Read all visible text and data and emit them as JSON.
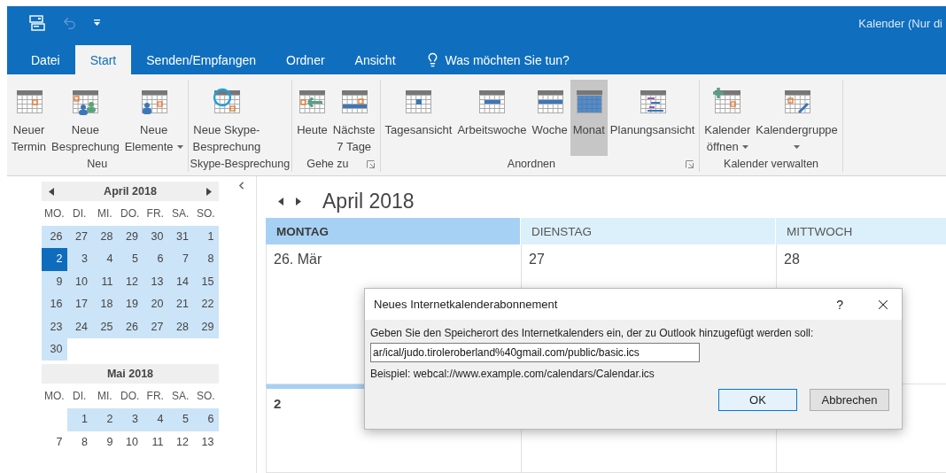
{
  "window": {
    "title": "Kalender (Nur di"
  },
  "tabs": [
    {
      "label": "Datei",
      "selected": false
    },
    {
      "label": "Start",
      "selected": true
    },
    {
      "label": "Senden/Empfangen",
      "selected": false
    },
    {
      "label": "Ordner",
      "selected": false
    },
    {
      "label": "Ansicht",
      "selected": false
    }
  ],
  "tell_me": {
    "placeholder": "Was möchten Sie tun?"
  },
  "ribbon_groups": [
    {
      "label": "Neu",
      "launcher": false,
      "buttons": [
        {
          "kind": "termin",
          "lines": [
            "Neuer",
            "Termin"
          ],
          "dropdown": false,
          "selected": false
        },
        {
          "kind": "besprechung",
          "lines": [
            "Neue",
            "Besprechung"
          ],
          "dropdown": false,
          "selected": false
        },
        {
          "kind": "elemente",
          "lines": [
            "Neue",
            "Elemente"
          ],
          "dropdown": true,
          "selected": false
        }
      ]
    },
    {
      "label": "Skype-Besprechung",
      "launcher": false,
      "buttons": [
        {
          "kind": "skype",
          "lines": [
            "Neue Skype-",
            "Besprechung"
          ],
          "dropdown": false,
          "selected": false
        }
      ]
    },
    {
      "label": "Gehe zu",
      "launcher": true,
      "buttons": [
        {
          "kind": "heute",
          "lines": [
            "Heute"
          ],
          "dropdown": false,
          "selected": false
        },
        {
          "kind": "naechste",
          "lines": [
            "Nächste",
            "7 Tage"
          ],
          "dropdown": false,
          "selected": false
        }
      ]
    },
    {
      "label": "Anordnen",
      "launcher": true,
      "buttons": [
        {
          "kind": "tag",
          "lines": [
            "Tagesansicht"
          ],
          "dropdown": false,
          "selected": false
        },
        {
          "kind": "arbeitswoche",
          "lines": [
            "Arbeitswoche"
          ],
          "dropdown": false,
          "selected": false
        },
        {
          "kind": "woche",
          "lines": [
            "Woche"
          ],
          "dropdown": false,
          "selected": false
        },
        {
          "kind": "monat",
          "lines": [
            "Monat"
          ],
          "dropdown": false,
          "selected": true
        },
        {
          "kind": "planung",
          "lines": [
            "Planungsansicht"
          ],
          "dropdown": false,
          "selected": false
        }
      ]
    },
    {
      "label": "Kalender verwalten",
      "launcher": false,
      "buttons": [
        {
          "kind": "oeffnen",
          "lines": [
            "Kalender",
            "öffnen"
          ],
          "dropdown": true,
          "selected": false
        },
        {
          "kind": "gruppe",
          "lines": [
            "Kalendergruppe"
          ],
          "dropdown": true,
          "selected": false
        }
      ]
    }
  ],
  "mini_calendars": [
    {
      "title": "April 2018",
      "arrows": true,
      "weekdays": [
        "MO.",
        "DI.",
        "MI.",
        "DO.",
        "FR.",
        "SA.",
        "SO."
      ],
      "weeks": [
        [
          {
            "label": "26",
            "highlighted": true,
            "selected": false
          },
          {
            "label": "27",
            "highlighted": true,
            "selected": false
          },
          {
            "label": "28",
            "highlighted": true,
            "selected": false
          },
          {
            "label": "29",
            "highlighted": true,
            "selected": false
          },
          {
            "label": "30",
            "highlighted": true,
            "selected": false
          },
          {
            "label": "31",
            "highlighted": true,
            "selected": false
          },
          {
            "label": "1",
            "highlighted": true,
            "selected": false
          }
        ],
        [
          {
            "label": "2",
            "highlighted": true,
            "selected": true
          },
          {
            "label": "3",
            "highlighted": true,
            "selected": false
          },
          {
            "label": "4",
            "highlighted": true,
            "selected": false
          },
          {
            "label": "5",
            "highlighted": true,
            "selected": false
          },
          {
            "label": "6",
            "highlighted": true,
            "selected": false
          },
          {
            "label": "7",
            "highlighted": true,
            "selected": false
          },
          {
            "label": "8",
            "highlighted": true,
            "selected": false
          }
        ],
        [
          {
            "label": "9",
            "highlighted": true,
            "selected": false
          },
          {
            "label": "10",
            "highlighted": true,
            "selected": false
          },
          {
            "label": "11",
            "highlighted": true,
            "selected": false
          },
          {
            "label": "12",
            "highlighted": true,
            "selected": false
          },
          {
            "label": "13",
            "highlighted": true,
            "selected": false
          },
          {
            "label": "14",
            "highlighted": true,
            "selected": false
          },
          {
            "label": "15",
            "highlighted": true,
            "selected": false
          }
        ],
        [
          {
            "label": "16",
            "highlighted": true,
            "selected": false
          },
          {
            "label": "17",
            "highlighted": true,
            "selected": false
          },
          {
            "label": "18",
            "highlighted": true,
            "selected": false
          },
          {
            "label": "19",
            "highlighted": true,
            "selected": false
          },
          {
            "label": "20",
            "highlighted": true,
            "selected": false
          },
          {
            "label": "21",
            "highlighted": true,
            "selected": false
          },
          {
            "label": "22",
            "highlighted": true,
            "selected": false
          }
        ],
        [
          {
            "label": "23",
            "highlighted": true,
            "selected": false
          },
          {
            "label": "24",
            "highlighted": true,
            "selected": false
          },
          {
            "label": "25",
            "highlighted": true,
            "selected": false
          },
          {
            "label": "26",
            "highlighted": true,
            "selected": false
          },
          {
            "label": "27",
            "highlighted": true,
            "selected": false
          },
          {
            "label": "28",
            "highlighted": true,
            "selected": false
          },
          {
            "label": "29",
            "highlighted": true,
            "selected": false
          }
        ],
        {
          "kind": "ends_early",
          "days": [
            {
              "label": "30",
              "highlighted": true,
              "selected": false
            }
          ]
        }
      ]
    },
    {
      "title": "Mai 2018",
      "arrows": false,
      "weekdays": [
        "MO.",
        "DI.",
        "MI.",
        "DO.",
        "FR.",
        "SA.",
        "SO."
      ],
      "weeks": [
        {
          "kind": "starts_late",
          "days": [
            {
              "label": "1",
              "highlighted": true,
              "selected": false
            },
            {
              "label": "2",
              "highlighted": true,
              "selected": false
            },
            {
              "label": "3",
              "highlighted": true,
              "selected": false
            },
            {
              "label": "4",
              "highlighted": true,
              "selected": false
            },
            {
              "label": "5",
              "highlighted": true,
              "selected": false
            },
            {
              "label": "6",
              "highlighted": true,
              "selected": false
            }
          ]
        },
        [
          {
            "label": "7",
            "highlighted": false,
            "selected": false
          },
          {
            "label": "8",
            "highlighted": false,
            "selected": false
          },
          {
            "label": "9",
            "highlighted": false,
            "selected": false
          },
          {
            "label": "10",
            "highlighted": false,
            "selected": false
          },
          {
            "label": "11",
            "highlighted": false,
            "selected": false
          },
          {
            "label": "12",
            "highlighted": false,
            "selected": false
          },
          {
            "label": "13",
            "highlighted": false,
            "selected": false
          }
        ]
      ]
    }
  ],
  "month_view": {
    "title": "April 2018",
    "columns": [
      {
        "label": "MONTAG",
        "selected": true
      },
      {
        "label": "DIENSTAG",
        "selected": false
      },
      {
        "label": "MITTWOCH",
        "selected": false
      }
    ],
    "rows": [
      [
        {
          "label": "26. Mär",
          "today": false
        },
        {
          "label": "27",
          "today": false
        },
        {
          "label": "28",
          "today": false
        }
      ],
      [
        {
          "label": "2",
          "today": true
        },
        {},
        {}
      ]
    ]
  },
  "dialog": {
    "title": "Neues Internetkalenderabonnement",
    "help": "?",
    "prompt": "Geben Sie den Speicherort des Internetkalenders ein, der zu Outlook hinzugefügt werden soll:",
    "value": "ar/ical/judo.tiroleroberland%40gmail.com/public/basic.ics",
    "example": "Beispiel: webcal://www.example.com/calendars/Calendar.ics",
    "buttons": [
      {
        "label": "OK",
        "default": true
      },
      {
        "label": "Abbrechen",
        "default": false
      }
    ]
  }
}
